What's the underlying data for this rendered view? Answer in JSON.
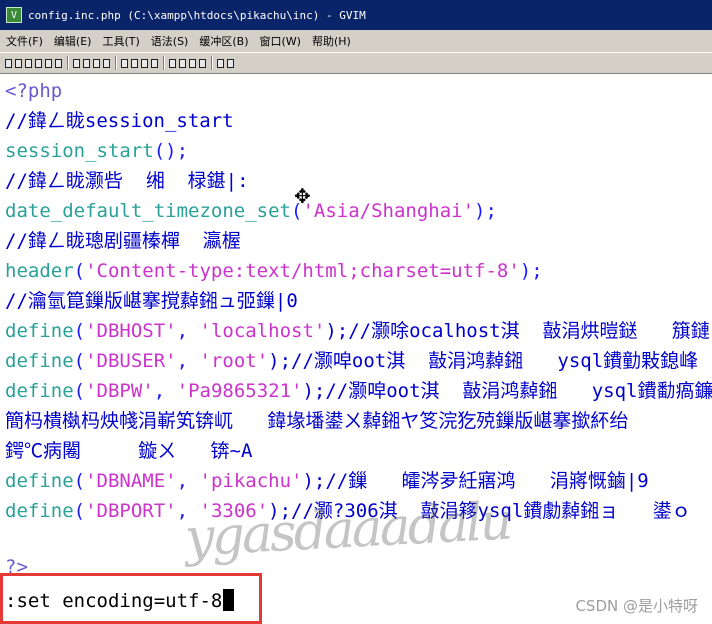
{
  "window": {
    "title": "config.inc.php (C:\\xampp\\htdocs\\pikachu\\inc) - GVIM",
    "app_icon": "vim-icon"
  },
  "menu": {
    "items": [
      "文件(F)",
      "编辑(E)",
      "工具(T)",
      "语法(S)",
      "缓冲区(B)",
      "窗口(W)",
      "帮助(H)"
    ]
  },
  "toolbar": {
    "icons": [
      "open-icon",
      "save-icon",
      "save-all-icon",
      "print-icon",
      "undo-icon",
      "redo-icon",
      "cut-icon",
      "copy-icon",
      "paste-icon",
      "find-replace-icon",
      "find-next-icon",
      "find-prev-icon",
      "load-session-icon",
      "save-session-icon",
      "run-script-icon",
      "make-icon",
      "shell-icon",
      "ctags-icon",
      "help-icon",
      "find-help-icon"
    ]
  },
  "editor": {
    "lines": [
      [
        {
          "t": "<?php",
          "c": "special"
        }
      ],
      [
        {
          "t": "//鍏ㄥ眬session_start",
          "c": "comment"
        }
      ],
      [
        {
          "t": "session_start",
          "c": "func"
        },
        {
          "t": "();",
          "c": "blue"
        }
      ],
      [
        {
          "t": "//鍏ㄥ眬灏呰  缃  椂鍖|:",
          "c": "comment"
        }
      ],
      [
        {
          "t": "date_default_timezone_set",
          "c": "func"
        },
        {
          "t": "(",
          "c": "blue"
        },
        {
          "t": "'Asia/Shanghai'",
          "c": "string"
        },
        {
          "t": ");",
          "c": "blue"
        }
      ],
      [
        {
          "t": "//鍏ㄥ眬璁剧疆榛樿  瀛楃",
          "c": "comment"
        }
      ],
      [
        {
          "t": "header",
          "c": "func"
        },
        {
          "t": "(",
          "c": "blue"
        },
        {
          "t": "'Content-type:text/html;charset=utf-8'",
          "c": "string"
        },
        {
          "t": ");",
          "c": "blue"
        }
      ],
      [
        {
          "t": "//瀹氫箟鏁版嵁搴撹繛鎺ュ弬鏁|0",
          "c": "comment"
        }
      ],
      [
        {
          "t": "define",
          "c": "func"
        },
        {
          "t": "(",
          "c": "blue"
        },
        {
          "t": "'DBHOST'",
          "c": "string"
        },
        {
          "t": ", ",
          "c": "blue"
        },
        {
          "t": "'localhost'",
          "c": "string"
        },
        {
          "t": ");//灏唋ocalhost淇  敼涓烘暟鎹   簱鏈",
          "c": "comment"
        }
      ],
      [
        {
          "t": "define",
          "c": "func"
        },
        {
          "t": "(",
          "c": "blue"
        },
        {
          "t": "'DBUSER'",
          "c": "string"
        },
        {
          "t": ", ",
          "c": "blue"
        },
        {
          "t": "'root'",
          "c": "string"
        },
        {
          "t": ");//灏唕oot淇  敼涓鸿繛鎺   ysql鐨勭敤鎴峰",
          "c": "comment"
        }
      ],
      [
        {
          "t": "define",
          "c": "func"
        },
        {
          "t": "(",
          "c": "blue"
        },
        {
          "t": "'DBPW'",
          "c": "string"
        },
        {
          "t": ", ",
          "c": "blue"
        },
        {
          "t": "'Pa9865321'",
          "c": "string"
        },
        {
          "t": ");//灏唕oot淇  敼涓鸿繛鎺   ysql鐨勫瘑鐮",
          "c": "comment"
        }
      ],
      [
        {
          "t": "簡杩樻槸杩炴帴涓嶄笂锛屼   鍏堟墦鍙ㄨ繛鎺ヤ笅浣犵殑鏁版嵁搴撳紑绐",
          "c": "comment"
        }
      ],
      [
        {
          "t": "鍔℃病闂     鏇ㄨ   锛~A",
          "c": "comment"
        }
      ],
      [
        {
          "t": "define",
          "c": "func"
        },
        {
          "t": "(",
          "c": "blue"
        },
        {
          "t": "'DBNAME'",
          "c": "string"
        },
        {
          "t": ", ",
          "c": "blue"
        },
        {
          "t": "'pikachu'",
          "c": "string"
        },
        {
          "t": ");//鏁   皬涔夛紝寤鸿   涓嶈慨鏀|9",
          "c": "comment"
        }
      ],
      [
        {
          "t": "define",
          "c": "func"
        },
        {
          "t": "(",
          "c": "blue"
        },
        {
          "t": "'DBPORT'",
          "c": "string"
        },
        {
          "t": ", ",
          "c": "blue"
        },
        {
          "t": "'3306'",
          "c": "string"
        },
        {
          "t": ");//灏?306淇  敼涓簃ysql鐨勮繛鎺ョ   鍙ｏ",
          "c": "comment"
        }
      ]
    ],
    "closing_tag": "?>"
  },
  "command_line": {
    "text": ":set encoding=utf-8"
  },
  "watermark": "CSDN @是小特呀",
  "colors": {
    "titlebar": "#0a246a",
    "menubar": "#d4d0c8",
    "highlight": "#e53935"
  }
}
